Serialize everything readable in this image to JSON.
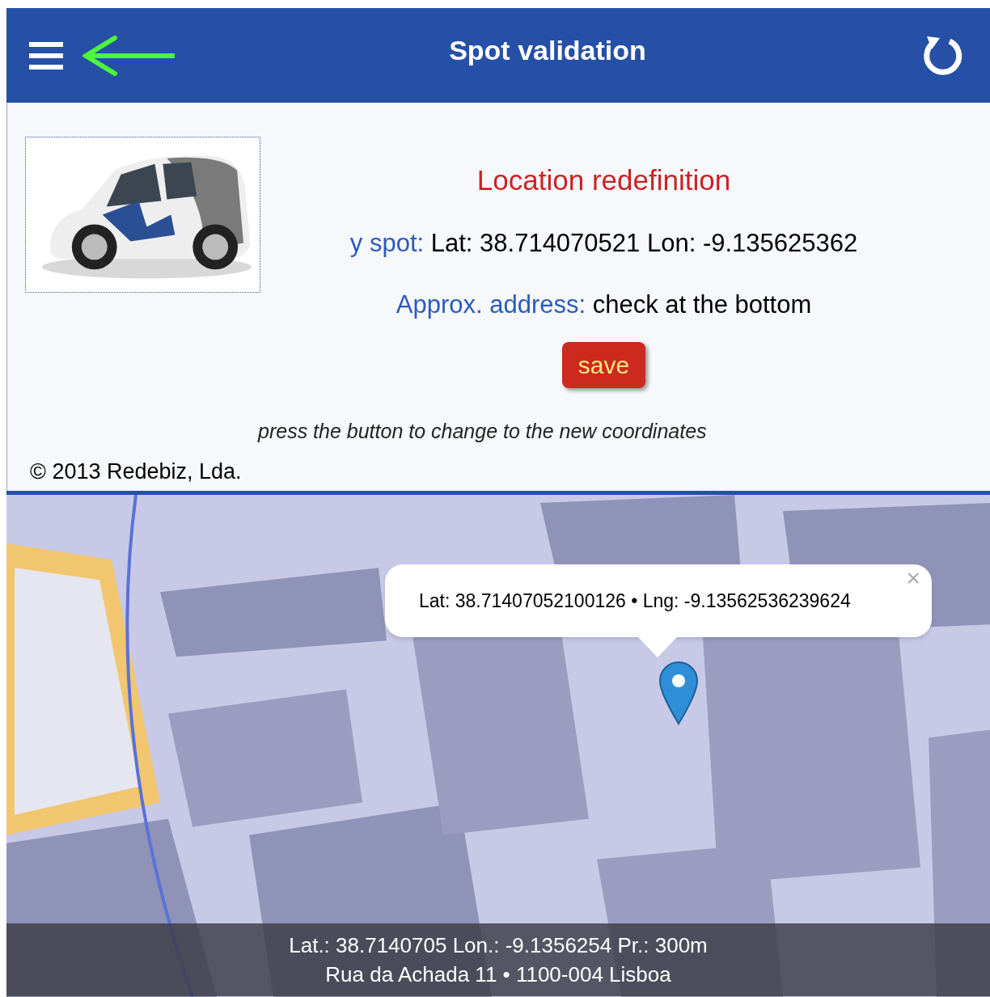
{
  "header": {
    "title": "Spot validation"
  },
  "panel": {
    "heading": "Location redefinition",
    "spot": {
      "label": "y spot:",
      "value": "Lat: 38.714070521 Lon: -9.135625362"
    },
    "address": {
      "label": "Approx. address:",
      "value": "check at the bottom"
    },
    "save_button": "save",
    "hint": "press the button to change to the new coordinates",
    "copyright": "© 2013 Redebiz, Lda."
  },
  "map": {
    "popup": {
      "text": "Lat: 38.71407052100126 • Lng: -9.13562536239624",
      "close": "×"
    },
    "info_bar": [
      "Lat.: 38.7140705 Lon.: -9.1356254 Pr.: 300m",
      "Rua da Achada 11 • 1100-004 Lisboa"
    ]
  }
}
